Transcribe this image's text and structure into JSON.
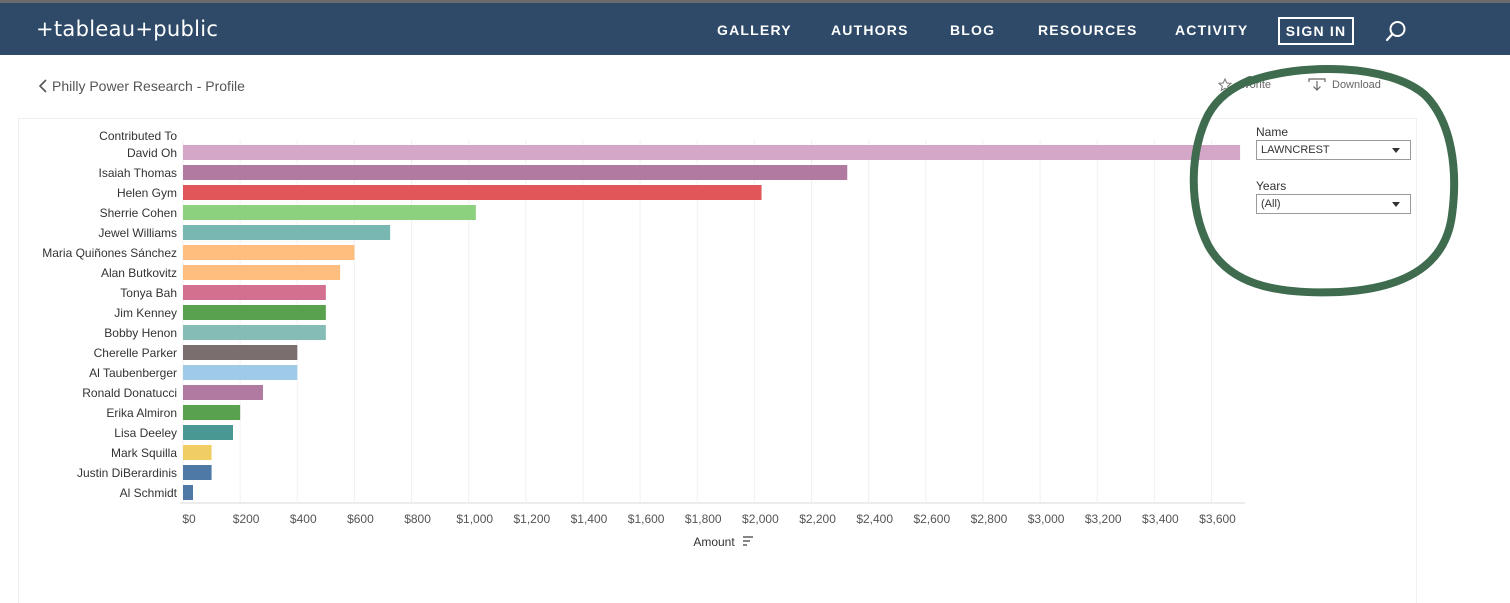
{
  "header": {
    "logo_text": "+tableau+public",
    "nav": [
      "GALLERY",
      "AUTHORS",
      "BLOG",
      "RESOURCES",
      "ACTIVITY"
    ],
    "sign_in_label": "SIGN IN",
    "search_icon": "search-icon",
    "background_color": "#2e4a68"
  },
  "breadcrumb": {
    "back_label": "Philly Power Research - Profile"
  },
  "toolbar": {
    "favorite_label": "avorite",
    "download_label": "Download"
  },
  "filters": {
    "name": {
      "title": "Name",
      "value": "LAWNCREST"
    },
    "years": {
      "title": "Years",
      "value": "(All)"
    }
  },
  "annotation": {
    "color": "#3f6b4f",
    "shape": "hand-drawn-circle"
  },
  "chart_data": {
    "type": "bar",
    "orientation": "horizontal",
    "category_header": "Contributed To",
    "xlabel": "Amount",
    "xlim": [
      0,
      3700
    ],
    "grid": true,
    "tick_labels": [
      "$0",
      "$200",
      "$400",
      "$600",
      "$800",
      "$1,000",
      "$1,200",
      "$1,400",
      "$1,600",
      "$1,800",
      "$2,000",
      "$2,200",
      "$2,400",
      "$2,600",
      "$2,800",
      "$3,000",
      "$3,200",
      "$3,400",
      "$3,600"
    ],
    "tick_values": [
      0,
      200,
      400,
      600,
      800,
      1000,
      1200,
      1400,
      1600,
      1800,
      2000,
      2200,
      2400,
      2600,
      2800,
      3000,
      3200,
      3400,
      3600
    ],
    "categories": [
      "David Oh",
      "Isaiah Thomas",
      "Helen Gym",
      "Sherrie Cohen",
      "Jewel Williams",
      "Maria Quiñones Sánchez",
      "Alan Butkovitz",
      "Tonya Bah",
      "Jim Kenney",
      "Bobby Henon",
      "Cherelle Parker",
      "Al Taubenberger",
      "Ronald Donatucci",
      "Erika Almiron",
      "Lisa Deeley",
      "Mark Squilla",
      "Justin DiBerardinis",
      "Al Schmidt"
    ],
    "values": [
      3700,
      2325,
      2025,
      1025,
      725,
      600,
      550,
      500,
      500,
      500,
      400,
      400,
      280,
      200,
      175,
      100,
      100,
      35
    ],
    "colors": [
      "#d4a6c8",
      "#b07aa1",
      "#e15759",
      "#8cd17d",
      "#79b7b2",
      "#ffbe7d",
      "#ffbe7d",
      "#d4708f",
      "#59a14f",
      "#86bcb6",
      "#7a6e6e",
      "#a0cbe8",
      "#b07aa1",
      "#59a14f",
      "#499894",
      "#f1ce63",
      "#4e79a7",
      "#4e79a7"
    ]
  }
}
